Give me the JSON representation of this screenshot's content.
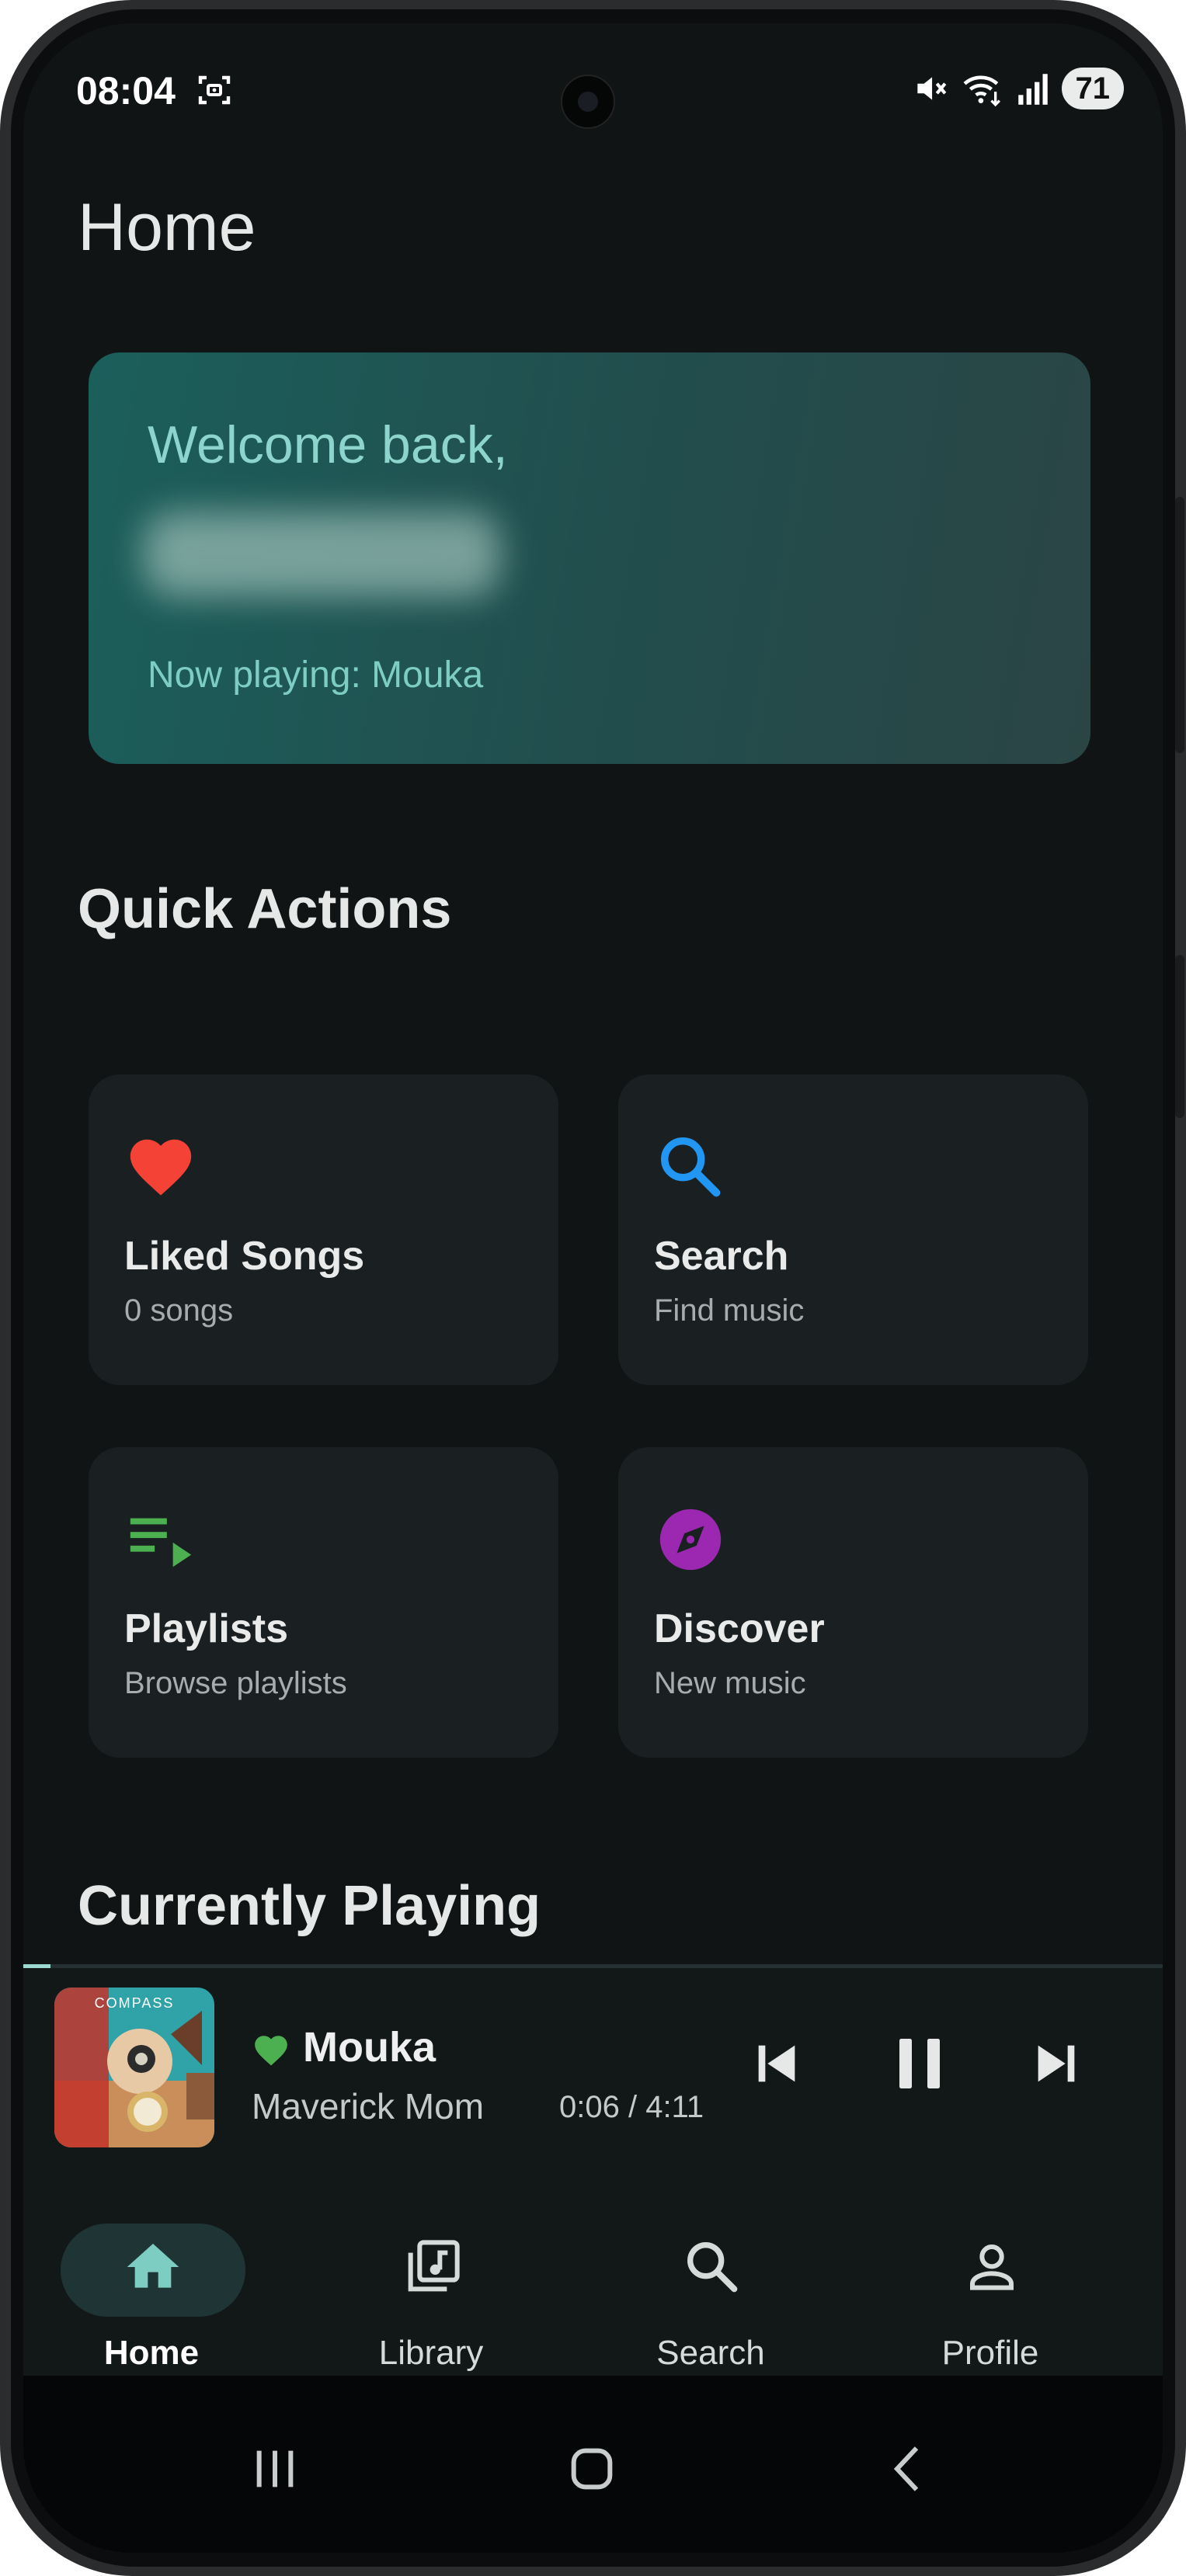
{
  "status_bar": {
    "time": "08:04",
    "battery": "71",
    "icons": [
      "screen-record-icon",
      "mute-icon",
      "wifi-icon",
      "signal-icon"
    ]
  },
  "page": {
    "title": "Home"
  },
  "welcome": {
    "greeting": "Welcome back,",
    "user_name_redacted": true,
    "now_playing": "Now playing: Mouka"
  },
  "quick_actions": {
    "title": "Quick Actions",
    "tiles": [
      {
        "icon": "heart-icon",
        "title": "Liked Songs",
        "subtitle": "0 songs",
        "color": "#f44336"
      },
      {
        "icon": "search-icon",
        "title": "Search",
        "subtitle": "Find music",
        "color": "#2196f3"
      },
      {
        "icon": "playlist-icon",
        "title": "Playlists",
        "subtitle": "Browse playlists",
        "color": "#4caf50"
      },
      {
        "icon": "compass-icon",
        "title": "Discover",
        "subtitle": "New music",
        "color": "#9c27b0"
      }
    ]
  },
  "currently_playing": {
    "title": "Currently Playing",
    "album_label": "COMPASS",
    "song": "Mouka",
    "artist": "Maverick Mom",
    "time": "0:06 / 4:11",
    "progress": 0.024,
    "liked": true,
    "like_color": "#4caf50"
  },
  "bottom_nav": {
    "items": [
      {
        "label": "Home",
        "icon": "home-icon",
        "active": true
      },
      {
        "label": "Library",
        "icon": "library-icon",
        "active": false
      },
      {
        "label": "Search",
        "icon": "search-icon",
        "active": false
      },
      {
        "label": "Profile",
        "icon": "profile-icon",
        "active": false
      }
    ]
  },
  "colors": {
    "accent": "#7ecdc2",
    "background": "#101415",
    "card": "#1a2021"
  }
}
